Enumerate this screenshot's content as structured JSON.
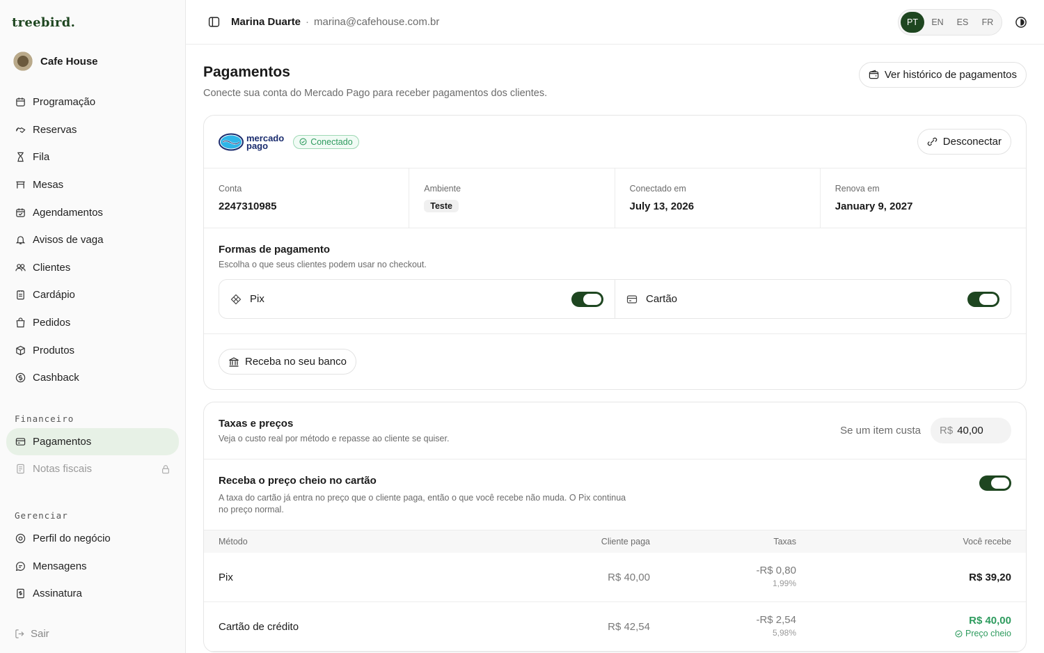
{
  "brand": "treebird.",
  "business": {
    "name": "Cafe House"
  },
  "sidebar": {
    "items": [
      {
        "label": "Programação",
        "icon": "calendar-icon"
      },
      {
        "label": "Reservas",
        "icon": "handshake-icon"
      },
      {
        "label": "Fila",
        "icon": "hourglass-icon"
      },
      {
        "label": "Mesas",
        "icon": "table-icon"
      },
      {
        "label": "Agendamentos",
        "icon": "calendar-check-icon"
      },
      {
        "label": "Avisos de vaga",
        "icon": "bell-icon"
      },
      {
        "label": "Clientes",
        "icon": "users-icon"
      },
      {
        "label": "Cardápio",
        "icon": "menu-book-icon"
      },
      {
        "label": "Pedidos",
        "icon": "bag-icon"
      },
      {
        "label": "Produtos",
        "icon": "box-icon"
      },
      {
        "label": "Cashback",
        "icon": "dollar-circle-icon"
      }
    ],
    "financeiro_label": "Financeiro",
    "financeiro_items": [
      {
        "label": "Pagamentos",
        "icon": "card-icon",
        "active": true
      },
      {
        "label": "Notas fiscais",
        "icon": "receipt-icon",
        "locked": true
      }
    ],
    "gerenciar_label": "Gerenciar",
    "gerenciar_items": [
      {
        "label": "Perfil do negócio",
        "icon": "location-icon"
      },
      {
        "label": "Mensagens",
        "icon": "chat-icon"
      },
      {
        "label": "Assinatura",
        "icon": "document-dollar-icon"
      }
    ],
    "logout_label": "Sair"
  },
  "topbar": {
    "user_name": "Marina Duarte",
    "separator": "·",
    "email": "marina@cafehouse.com.br",
    "languages": [
      "PT",
      "EN",
      "ES",
      "FR"
    ],
    "active_language": "PT"
  },
  "page": {
    "title": "Pagamentos",
    "subtitle": "Conecte sua conta do Mercado Pago para receber pagamentos dos clientes.",
    "history_button": "Ver histórico de pagamentos"
  },
  "provider": {
    "logo_text_1": "mercado",
    "logo_text_2": "pago",
    "status": "Conectado",
    "disconnect_button": "Desconectar",
    "account_label": "Conta",
    "account_value": "2247310985",
    "environment_label": "Ambiente",
    "environment_value": "Teste",
    "connected_label": "Conectado em",
    "connected_value": "July 13, 2026",
    "renew_label": "Renova em",
    "renew_value": "January 9, 2027"
  },
  "payment_methods": {
    "title": "Formas de pagamento",
    "subtitle": "Escolha o que seus clientes podem usar no checkout.",
    "pix_label": "Pix",
    "pix_enabled": true,
    "card_label": "Cartão",
    "card_enabled": true,
    "bank_button": "Receba no seu banco"
  },
  "fees": {
    "title": "Taxas e preços",
    "subtitle": "Veja o custo real por método e repasse ao cliente se quiser.",
    "price_prompt": "Se um item custa",
    "currency": "R$",
    "price_value": "40,00",
    "full_price_title": "Receba o preço cheio no cartão",
    "full_price_desc": "A taxa do cartão já entra no preço que o cliente paga, então o que você recebe não muda. O Pix continua no preço normal.",
    "full_price_enabled": true,
    "columns": [
      "Método",
      "Cliente paga",
      "Taxas",
      "Você recebe"
    ],
    "rows": [
      {
        "method": "Pix",
        "client_pays": "R$ 40,00",
        "fee": "-R$ 0,80",
        "fee_pct": "1,99%",
        "receive": "R$ 39,20",
        "note": ""
      },
      {
        "method": "Cartão de crédito",
        "client_pays": "R$ 42,54",
        "fee": "-R$ 2,54",
        "fee_pct": "5,98%",
        "receive": "R$ 40,00",
        "note": "Preço cheio"
      }
    ]
  }
}
